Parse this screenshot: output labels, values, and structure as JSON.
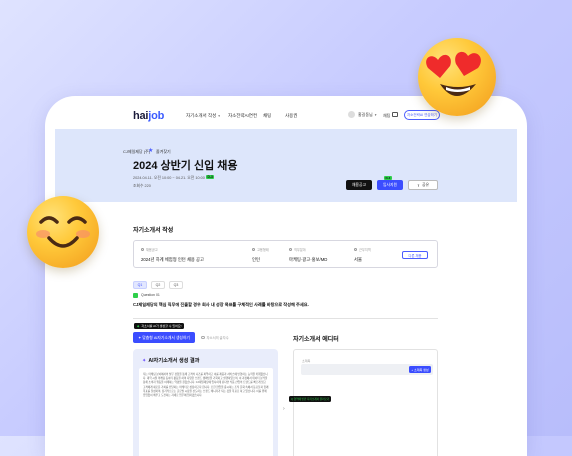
{
  "nav": {
    "logo_prefix": "hai",
    "logo_suffix": "job",
    "menu": [
      "자기소개서 작성",
      "자소전략AI연컨",
      "채팅",
      "사용권"
    ],
    "user": "홍길동님",
    "bell_label": "채팅",
    "cta": "자소전략AI 연습하기"
  },
  "banner": {
    "company": "CJ제일제당 (주)",
    "favorite": "즐겨찾기",
    "title": "2024 상반기 신입 채용",
    "period": "2024.04.11. 오전 10:00 ~ 04.21. 오전 10:00",
    "dday": "D-3",
    "views": "조회수 220",
    "notice_button": "채용공고",
    "apply_button": "입사지원",
    "apply_badge": "D-3",
    "share_button": "공유"
  },
  "section": {
    "title": "자기소개서 작성",
    "posting": [
      {
        "label": "채용공고",
        "value": "2024년 하계 체험형 인턴 채용 공고"
      },
      {
        "label": "고용형태",
        "value": "인턴"
      },
      {
        "label": "직무분야",
        "value": "마케팅·광고·홍보/MD"
      },
      {
        "label": "근무지역",
        "value": "서울"
      }
    ],
    "change_button": "다른 채용"
  },
  "tabs": [
    "Q1",
    "Q2",
    "Q3"
  ],
  "question": {
    "label": "Question 01",
    "text": "CJ제일제당의 핵심 직무에 진출할 경우 회사 내 성장 목표를 구체적인 사례를 바탕으로 작성해 주세요."
  },
  "ai": {
    "tooltip_icon": "◆",
    "tooltip": "자소서를 AI가 생성할 수 있어요!",
    "button": "✦ 맞춤형 AI자기소개서 생성하기",
    "note": "자소서의 글자수"
  },
  "result": {
    "title": "AI자기소개서 생성 결과",
    "text": "저는 마케팅 분야에서의 실무 경험을 통해 고객의 니즈를 파악하고 이를 제품과 서비스에 반영하는 능력을 키워왔습니다. 대학 시절 마케팅 동아리 활동을 하며 다양한 브랜드 캠페인을 기획하고 실행하였으며, 이 과정에서 데이터 분석을 통해 소비자 행동을 이해하는 역량을 길렀습니다. CJ제일제당에 입사하게 된다면 식품 산업의 트렌드를 빠르게 읽고 고객에게 새로운 가치를 전달하는 마케터로 성장하고자 합니다. 또한 협업을 중시하는 조직 문화 속에서 동료들과 함께 목표를 달성하며, 장기적으로는 글로벌 시장을 선도하는 브랜드 매니저가 되는 것을 목표로 하고 있습니다. 이를 위해 끊임없이 배우고 도전하는 자세로 업무에 임하겠습니다."
  },
  "editor": {
    "title": "자기소개서 에디터",
    "label": "소제목",
    "save": "+ 소제목 생성",
    "float_tip": "Q 영역에 빈칸 자기소개서 불러오기"
  },
  "colors": {
    "accent": "#3b4dff",
    "banner": "#dde6fb",
    "badge": "#2ecf4a"
  }
}
